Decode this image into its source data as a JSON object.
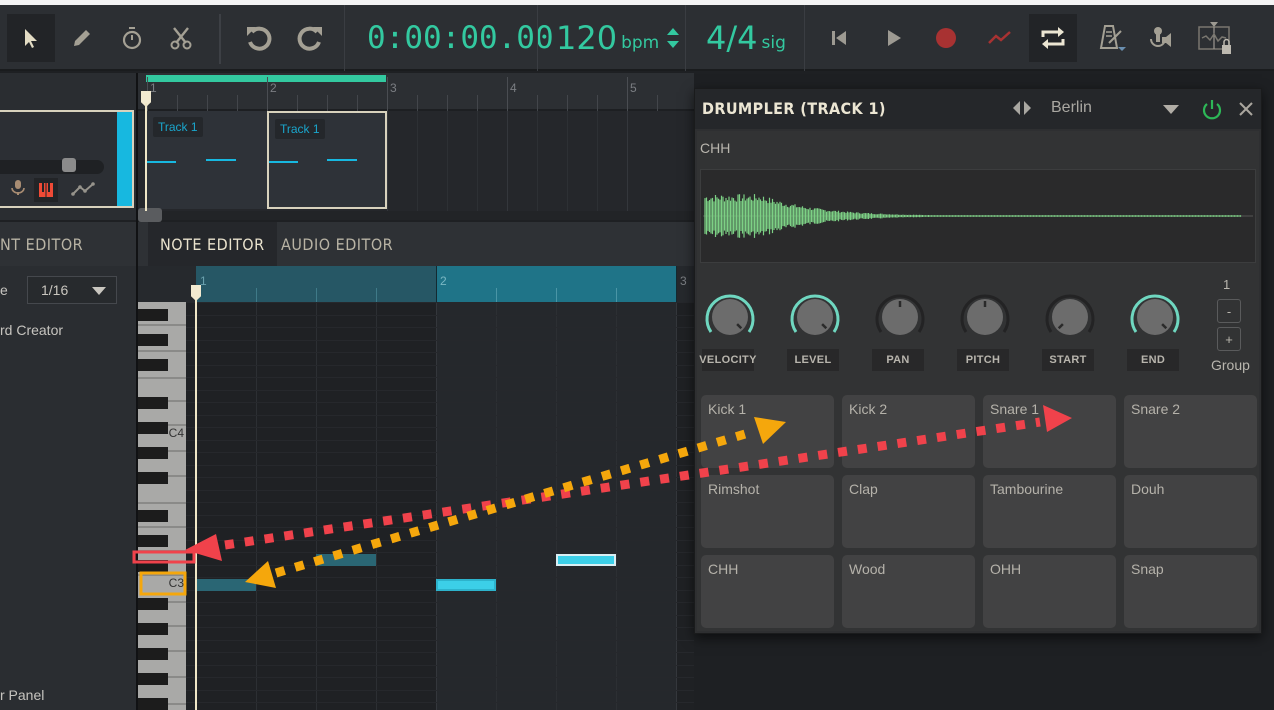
{
  "toolbar": {
    "tools": [
      {
        "name": "select-tool",
        "icon": "arrow-pointer-icon",
        "active": true
      },
      {
        "name": "pencil-tool",
        "icon": "pencil-icon",
        "active": false
      },
      {
        "name": "stopwatch-tool",
        "icon": "stopwatch-icon",
        "active": false
      },
      {
        "name": "cut-tool",
        "icon": "scissors-icon",
        "active": false
      }
    ],
    "undo_icon": "undo-icon",
    "redo_icon": "redo-icon",
    "time": "0:00:00.00",
    "tempo": "120",
    "tempo_unit": "bpm",
    "signature": "4/4",
    "signature_unit": "sig",
    "transport": [
      "skip-to-start-icon",
      "play-icon",
      "record-icon",
      "automation-icon",
      "loop-icon",
      "metronome-icon",
      "input-monitor-icon",
      "snap-lock-icon"
    ],
    "accent": "#33c9a0",
    "record_color": "#a83232"
  },
  "arranger": {
    "ruler_numbers": [
      "1",
      "2",
      "3",
      "4",
      "5"
    ],
    "clips": [
      {
        "label": "Track 1",
        "selected": false
      },
      {
        "label": "Track 1",
        "selected": true
      }
    ],
    "track_color": "#17b8e0",
    "track_icons": [
      "microphone-icon",
      "piano-keys-icon",
      "automation-line-icon"
    ]
  },
  "editor": {
    "tabs": [
      {
        "label": "NT EDITOR",
        "active": false
      },
      {
        "label": "NOTE EDITOR",
        "active": true
      },
      {
        "label": "AUDIO EDITOR",
        "active": false
      }
    ],
    "quantize_label": "e",
    "quantize_value": "1/16",
    "chord_creator_label": "rd Creator",
    "panel_label": "r Panel",
    "ruler_numbers": [
      "1",
      "2",
      "3"
    ],
    "key_labels": [
      "C4",
      "C3"
    ]
  },
  "drumpler": {
    "title": "DRUMPLER (TRACK 1)",
    "preset": "Berlin",
    "sample_name": "CHH",
    "waveform_color": "#7dd185",
    "knobs": [
      {
        "label": "VELOCITY",
        "active": true
      },
      {
        "label": "LEVEL",
        "active": true
      },
      {
        "label": "PAN",
        "active": false
      },
      {
        "label": "PITCH",
        "active": false
      },
      {
        "label": "START",
        "active": false
      },
      {
        "label": "END",
        "active": true
      }
    ],
    "group": {
      "value": "1",
      "minus": "-",
      "plus": "+",
      "label": "Group"
    },
    "pads": [
      "Kick 1",
      "Kick 2",
      "Snare 1",
      "Snare 2",
      "Rimshot",
      "Clap",
      "Tambourine",
      "Douh",
      "CHH",
      "Wood",
      "OHH",
      "Snap"
    ]
  },
  "annotations": {
    "red_color": "#f0424b",
    "orange_color": "#f5a70c"
  }
}
